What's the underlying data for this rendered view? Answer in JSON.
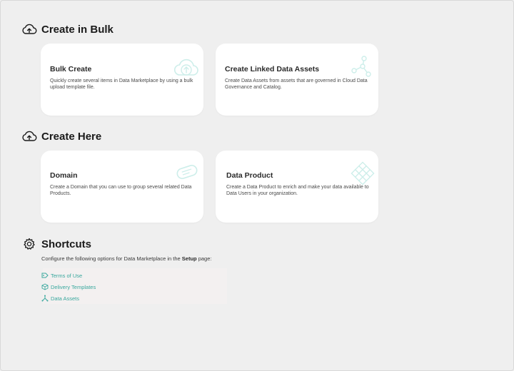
{
  "sections": {
    "bulk": {
      "title": "Create in Bulk",
      "icon": "cloud-upload-icon"
    },
    "here": {
      "title": "Create Here",
      "icon": "cloud-upload-icon"
    },
    "shortcuts": {
      "title": "Shortcuts",
      "icon": "gear-icon"
    }
  },
  "cards": {
    "bulk_create": {
      "title": "Bulk Create",
      "description": "Quickly create several items in Data Marketplace by using a bulk upload template file.",
      "icon": "cloud-upload-illustration"
    },
    "linked_assets": {
      "title": "Create Linked Data Assets",
      "description": "Create Data Assets from assets that are governed in Cloud Data Governance and Catalog.",
      "icon": "network-nodes-illustration"
    },
    "domain": {
      "title": "Domain",
      "description": "Create a Domain that you can use to group several related Data Products.",
      "icon": "domain-badge-illustration"
    },
    "data_product": {
      "title": "Data Product",
      "description": "Create a Data Product to enrich and make your data available to Data Users in your organization.",
      "icon": "grid-diamond-illustration"
    }
  },
  "shortcuts": {
    "desc_prefix": "Configure the following options for Data Marketplace in the ",
    "desc_bold": "Setup",
    "desc_suffix": " page:",
    "links": {
      "terms": {
        "label": "Terms of Use",
        "icon": "tag-icon"
      },
      "delivery": {
        "label": "Delivery Templates",
        "icon": "box-icon"
      },
      "assets": {
        "label": "Data Assets",
        "icon": "nodes-icon"
      }
    }
  },
  "colors": {
    "accent": "#3aa89e",
    "illustration": "#cdeeea",
    "background": "#efefef",
    "card": "#ffffff"
  }
}
